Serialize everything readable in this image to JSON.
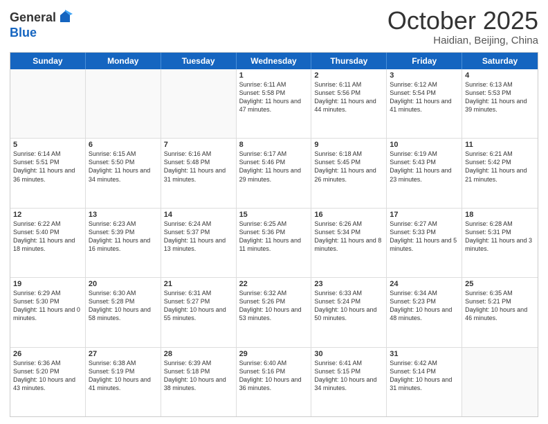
{
  "header": {
    "logo_general": "General",
    "logo_blue": "Blue",
    "month": "October 2025",
    "location": "Haidian, Beijing, China"
  },
  "days_of_week": [
    "Sunday",
    "Monday",
    "Tuesday",
    "Wednesday",
    "Thursday",
    "Friday",
    "Saturday"
  ],
  "rows": [
    [
      {
        "day": "",
        "empty": true
      },
      {
        "day": "",
        "empty": true
      },
      {
        "day": "",
        "empty": true
      },
      {
        "day": "1",
        "sunrise": "6:11 AM",
        "sunset": "5:58 PM",
        "daylight": "11 hours and 47 minutes."
      },
      {
        "day": "2",
        "sunrise": "6:11 AM",
        "sunset": "5:56 PM",
        "daylight": "11 hours and 44 minutes."
      },
      {
        "day": "3",
        "sunrise": "6:12 AM",
        "sunset": "5:54 PM",
        "daylight": "11 hours and 41 minutes."
      },
      {
        "day": "4",
        "sunrise": "6:13 AM",
        "sunset": "5:53 PM",
        "daylight": "11 hours and 39 minutes."
      }
    ],
    [
      {
        "day": "5",
        "sunrise": "6:14 AM",
        "sunset": "5:51 PM",
        "daylight": "11 hours and 36 minutes."
      },
      {
        "day": "6",
        "sunrise": "6:15 AM",
        "sunset": "5:50 PM",
        "daylight": "11 hours and 34 minutes."
      },
      {
        "day": "7",
        "sunrise": "6:16 AM",
        "sunset": "5:48 PM",
        "daylight": "11 hours and 31 minutes."
      },
      {
        "day": "8",
        "sunrise": "6:17 AM",
        "sunset": "5:46 PM",
        "daylight": "11 hours and 29 minutes."
      },
      {
        "day": "9",
        "sunrise": "6:18 AM",
        "sunset": "5:45 PM",
        "daylight": "11 hours and 26 minutes."
      },
      {
        "day": "10",
        "sunrise": "6:19 AM",
        "sunset": "5:43 PM",
        "daylight": "11 hours and 23 minutes."
      },
      {
        "day": "11",
        "sunrise": "6:21 AM",
        "sunset": "5:42 PM",
        "daylight": "11 hours and 21 minutes."
      }
    ],
    [
      {
        "day": "12",
        "sunrise": "6:22 AM",
        "sunset": "5:40 PM",
        "daylight": "11 hours and 18 minutes."
      },
      {
        "day": "13",
        "sunrise": "6:23 AM",
        "sunset": "5:39 PM",
        "daylight": "11 hours and 16 minutes."
      },
      {
        "day": "14",
        "sunrise": "6:24 AM",
        "sunset": "5:37 PM",
        "daylight": "11 hours and 13 minutes."
      },
      {
        "day": "15",
        "sunrise": "6:25 AM",
        "sunset": "5:36 PM",
        "daylight": "11 hours and 11 minutes."
      },
      {
        "day": "16",
        "sunrise": "6:26 AM",
        "sunset": "5:34 PM",
        "daylight": "11 hours and 8 minutes."
      },
      {
        "day": "17",
        "sunrise": "6:27 AM",
        "sunset": "5:33 PM",
        "daylight": "11 hours and 5 minutes."
      },
      {
        "day": "18",
        "sunrise": "6:28 AM",
        "sunset": "5:31 PM",
        "daylight": "11 hours and 3 minutes."
      }
    ],
    [
      {
        "day": "19",
        "sunrise": "6:29 AM",
        "sunset": "5:30 PM",
        "daylight": "11 hours and 0 minutes."
      },
      {
        "day": "20",
        "sunrise": "6:30 AM",
        "sunset": "5:28 PM",
        "daylight": "10 hours and 58 minutes."
      },
      {
        "day": "21",
        "sunrise": "6:31 AM",
        "sunset": "5:27 PM",
        "daylight": "10 hours and 55 minutes."
      },
      {
        "day": "22",
        "sunrise": "6:32 AM",
        "sunset": "5:26 PM",
        "daylight": "10 hours and 53 minutes."
      },
      {
        "day": "23",
        "sunrise": "6:33 AM",
        "sunset": "5:24 PM",
        "daylight": "10 hours and 50 minutes."
      },
      {
        "day": "24",
        "sunrise": "6:34 AM",
        "sunset": "5:23 PM",
        "daylight": "10 hours and 48 minutes."
      },
      {
        "day": "25",
        "sunrise": "6:35 AM",
        "sunset": "5:21 PM",
        "daylight": "10 hours and 46 minutes."
      }
    ],
    [
      {
        "day": "26",
        "sunrise": "6:36 AM",
        "sunset": "5:20 PM",
        "daylight": "10 hours and 43 minutes."
      },
      {
        "day": "27",
        "sunrise": "6:38 AM",
        "sunset": "5:19 PM",
        "daylight": "10 hours and 41 minutes."
      },
      {
        "day": "28",
        "sunrise": "6:39 AM",
        "sunset": "5:18 PM",
        "daylight": "10 hours and 38 minutes."
      },
      {
        "day": "29",
        "sunrise": "6:40 AM",
        "sunset": "5:16 PM",
        "daylight": "10 hours and 36 minutes."
      },
      {
        "day": "30",
        "sunrise": "6:41 AM",
        "sunset": "5:15 PM",
        "daylight": "10 hours and 34 minutes."
      },
      {
        "day": "31",
        "sunrise": "6:42 AM",
        "sunset": "5:14 PM",
        "daylight": "10 hours and 31 minutes."
      },
      {
        "day": "",
        "empty": true
      }
    ]
  ]
}
